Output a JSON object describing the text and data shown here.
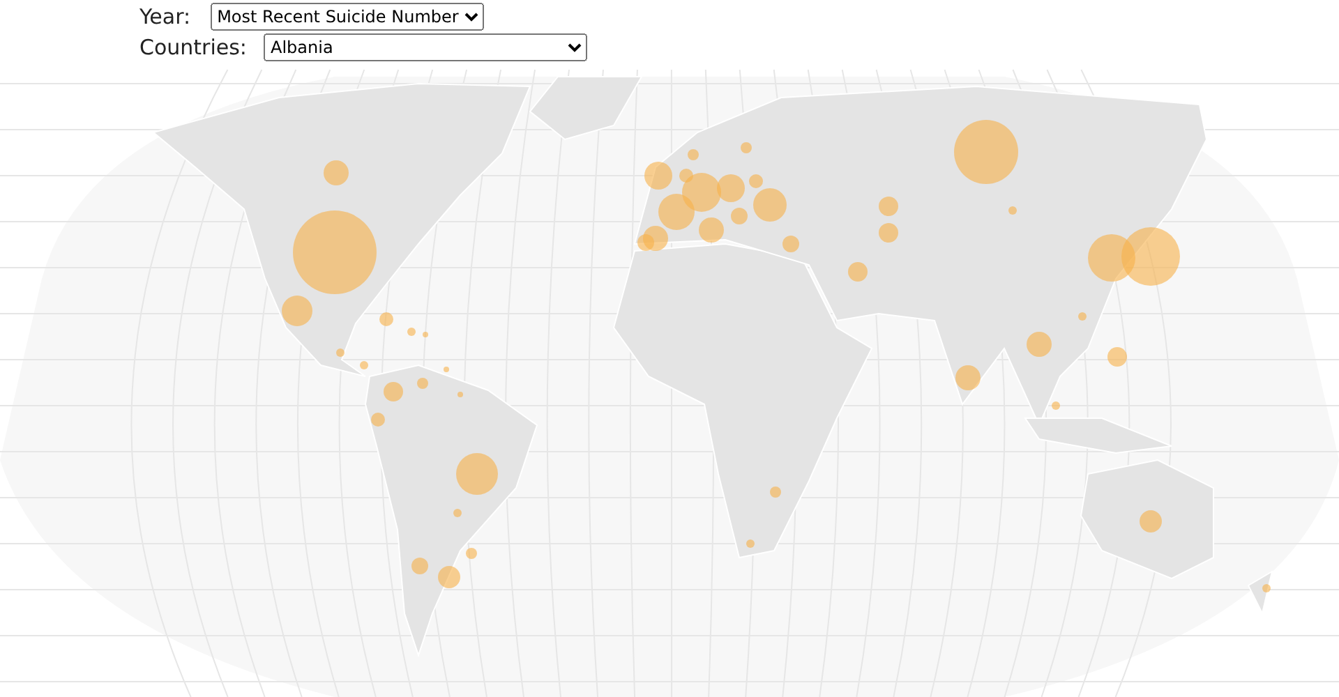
{
  "controls": [
    {
      "label": "Year:",
      "value": "Most Recent Suicide Number",
      "kind": "year"
    },
    {
      "label": "Countries:",
      "value": "Albania",
      "kind": "countries"
    }
  ]
}
